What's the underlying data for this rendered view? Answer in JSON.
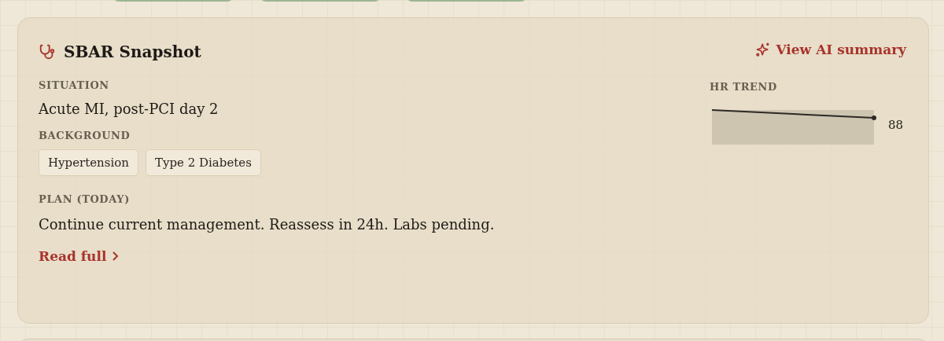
{
  "card": {
    "title": "SBAR Snapshot",
    "action": "View AI summary",
    "situation": {
      "label": "SITUATION",
      "text": "Acute MI, post-PCI day 2"
    },
    "background": {
      "label": "BACKGROUND",
      "tags": [
        "Hypertension",
        "Type 2 Diabetes"
      ]
    },
    "plan": {
      "label": "PLAN (TODAY)",
      "text": "Continue current management. Reassess in 24h. Labs pending."
    },
    "read_more": "Read full",
    "trend": {
      "label": "HR TREND",
      "value": "88"
    }
  }
}
